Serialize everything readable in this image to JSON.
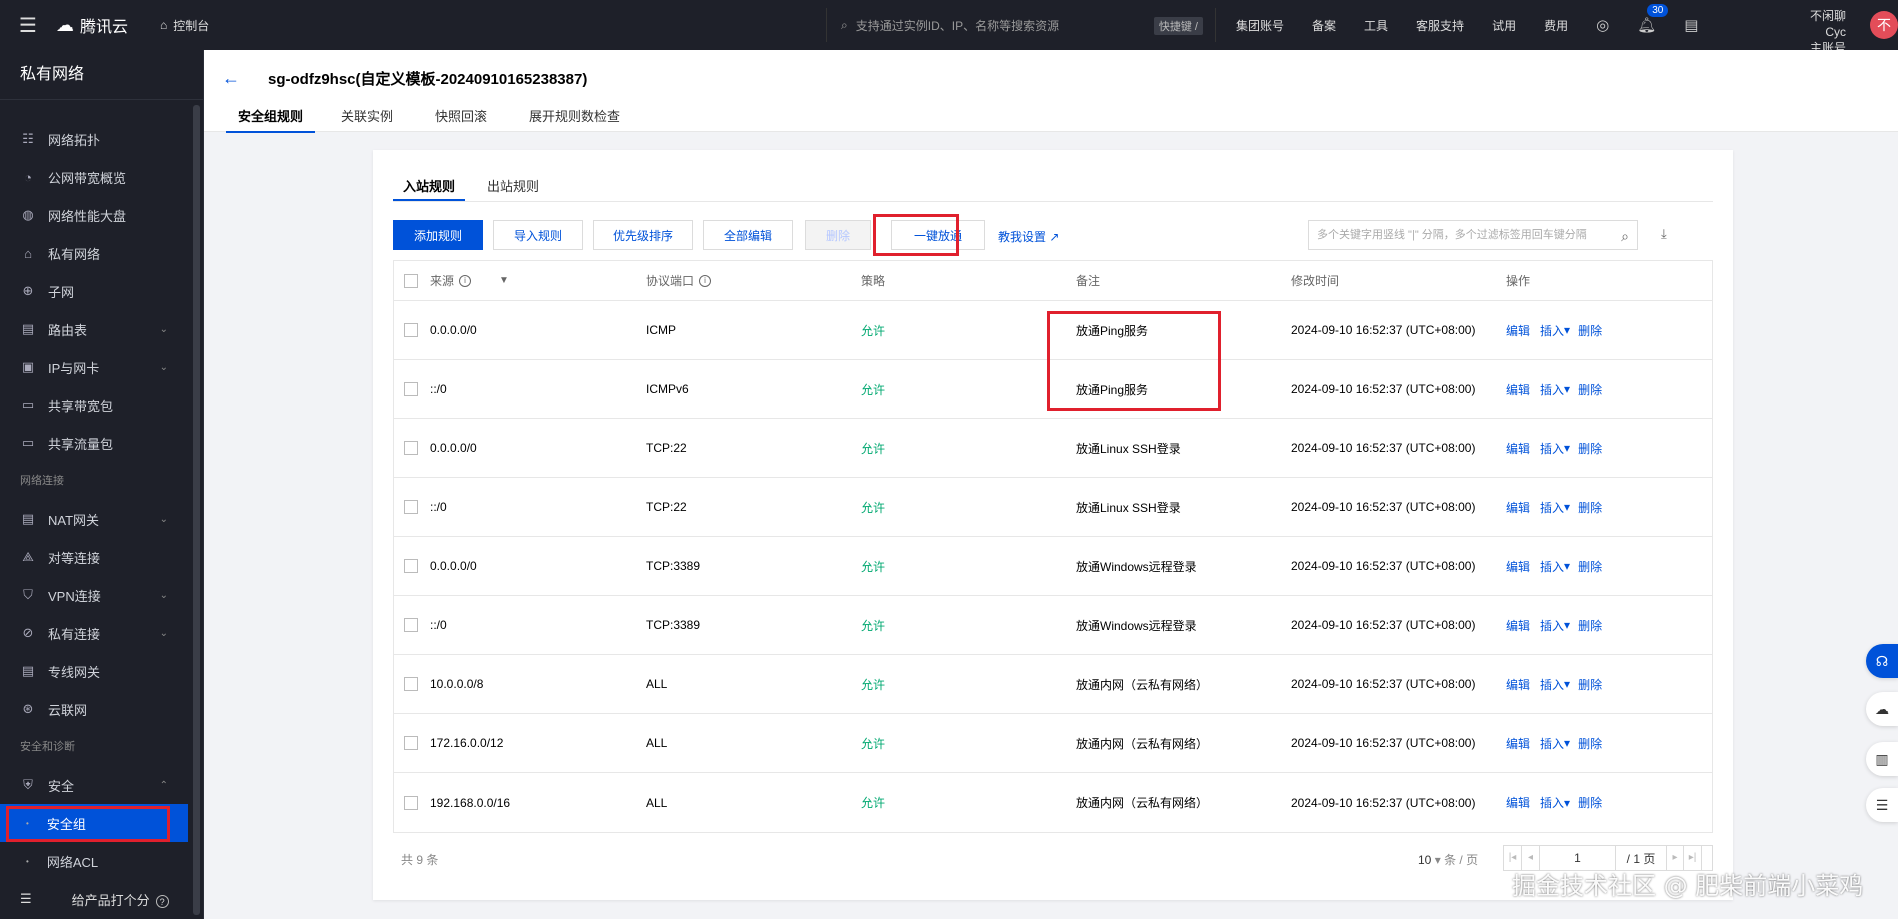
{
  "topbar": {
    "brand": "腾讯云",
    "console": "控制台",
    "search_placeholder": "支持通过实例ID、IP、名称等搜索资源",
    "shortcut": "快捷键 /",
    "nav": [
      "集团账号",
      "备案",
      "工具",
      "客服支持",
      "试用",
      "费用"
    ],
    "notify_count": "30",
    "account_name": "不闲聊Cyc",
    "account_role": "主账号",
    "avatar_char": "不"
  },
  "sidebar": {
    "title": "私有网络",
    "items": [
      {
        "label": "网络拓扑",
        "icon": "topology-icon"
      },
      {
        "label": "公网带宽概览",
        "icon": "bandwidth-icon"
      },
      {
        "label": "网络性能大盘",
        "icon": "performance-icon"
      },
      {
        "label": "私有网络",
        "icon": "vpc-icon"
      },
      {
        "label": "子网",
        "icon": "subnet-icon"
      },
      {
        "label": "路由表",
        "icon": "route-table-icon"
      },
      {
        "label": "IP与网卡",
        "icon": "ip-nic-icon"
      },
      {
        "label": "共享带宽包",
        "icon": "shared-bandwidth-icon"
      },
      {
        "label": "共享流量包",
        "icon": "shared-traffic-icon"
      }
    ],
    "group_connect": "网络连接",
    "connect_items": [
      {
        "label": "NAT网关",
        "icon": "nat-icon"
      },
      {
        "label": "对等连接",
        "icon": "peering-icon"
      },
      {
        "label": "VPN连接",
        "icon": "vpn-icon"
      },
      {
        "label": "私有连接",
        "icon": "private-link-icon"
      },
      {
        "label": "专线网关",
        "icon": "dc-gateway-icon"
      },
      {
        "label": "云联网",
        "icon": "ccn-icon"
      }
    ],
    "group_security": "安全和诊断",
    "security_label": "安全",
    "security_sub": [
      "安全组",
      "网络ACL"
    ],
    "feedback": "给产品打个分"
  },
  "header": {
    "title": "sg-odfz9hsc(自定义模板-20240910165238387)",
    "tabs": [
      "安全组规则",
      "关联实例",
      "快照回滚",
      "展开规则数检查"
    ]
  },
  "card": {
    "subtabs": [
      "入站规则",
      "出站规则"
    ],
    "buttons": {
      "add": "添加规则",
      "import": "导入规则",
      "priority": "优先级排序",
      "edit_all": "全部编辑",
      "delete": "删除",
      "one_click": "一键放通",
      "tutorial": "教我设置"
    },
    "search_placeholder": "多个关键字用竖线 \"|\" 分隔，多个过滤标签用回车键分隔",
    "columns": [
      "来源",
      "协议端口",
      "策略",
      "备注",
      "修改时间",
      "操作"
    ],
    "rows": [
      {
        "source": "0.0.0.0/0",
        "port": "ICMP",
        "policy": "允许",
        "note": "放通Ping服务",
        "time": "2024-09-10 16:52:37 (UTC+08:00)"
      },
      {
        "source": "::/0",
        "port": "ICMPv6",
        "policy": "允许",
        "note": "放通Ping服务",
        "time": "2024-09-10 16:52:37 (UTC+08:00)"
      },
      {
        "source": "0.0.0.0/0",
        "port": "TCP:22",
        "policy": "允许",
        "note": "放通Linux SSH登录",
        "time": "2024-09-10 16:52:37 (UTC+08:00)"
      },
      {
        "source": "::/0",
        "port": "TCP:22",
        "policy": "允许",
        "note": "放通Linux SSH登录",
        "time": "2024-09-10 16:52:37 (UTC+08:00)"
      },
      {
        "source": "0.0.0.0/0",
        "port": "TCP:3389",
        "policy": "允许",
        "note": "放通Windows远程登录",
        "time": "2024-09-10 16:52:37 (UTC+08:00)"
      },
      {
        "source": "::/0",
        "port": "TCP:3389",
        "policy": "允许",
        "note": "放通Windows远程登录",
        "time": "2024-09-10 16:52:37 (UTC+08:00)"
      },
      {
        "source": "10.0.0.0/8",
        "port": "ALL",
        "policy": "允许",
        "note": "放通内网（云私有网络）",
        "time": "2024-09-10 16:52:37 (UTC+08:00)"
      },
      {
        "source": "172.16.0.0/12",
        "port": "ALL",
        "policy": "允许",
        "note": "放通内网（云私有网络）",
        "time": "2024-09-10 16:52:37 (UTC+08:00)"
      },
      {
        "source": "192.168.0.0/16",
        "port": "ALL",
        "policy": "允许",
        "note": "放通内网（云私有网络）",
        "time": "2024-09-10 16:52:37 (UTC+08:00)"
      }
    ],
    "ops": {
      "edit": "编辑",
      "insert": "插入",
      "delete": "删除"
    },
    "pager": {
      "total": "共 9 条",
      "per_page": "10",
      "per_unit": "条 / 页",
      "page": "1",
      "pages": "/ 1 页"
    }
  },
  "watermark": "掘金技术社区 @ 肥柴前端小菜鸡",
  "colors": {
    "accent": "#0052d9",
    "allow": "#00a870",
    "highlight": "#e0202d",
    "dark": "#1e2029"
  }
}
